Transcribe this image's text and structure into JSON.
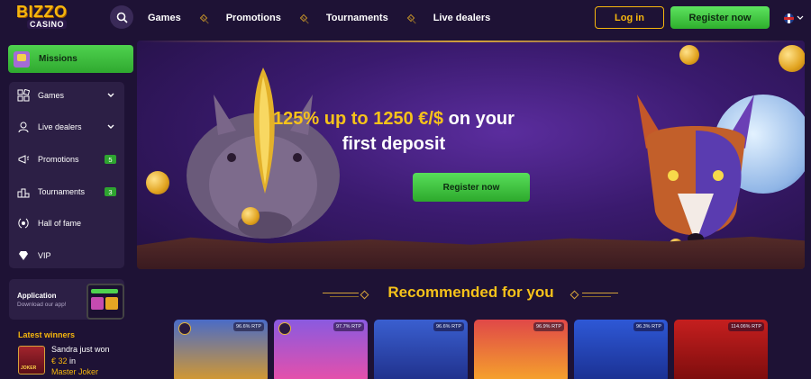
{
  "brand": {
    "line1": "BIZZO",
    "line2": "CASINO"
  },
  "nav": {
    "items": [
      "Games",
      "Promotions",
      "Tournaments",
      "Live dealers"
    ],
    "login_label": "Log in",
    "register_label": "Register now"
  },
  "sidebar": {
    "missions_label": "Missions",
    "items": [
      {
        "label": "Games",
        "icon": "games-icon",
        "has_chevron": true
      },
      {
        "label": "Live dealers",
        "icon": "dealer-icon",
        "has_chevron": true
      },
      {
        "label": "Promotions",
        "icon": "megaphone-icon",
        "badge": "5"
      },
      {
        "label": "Tournaments",
        "icon": "tournament-icon",
        "badge": "3"
      },
      {
        "label": "Hall of fame",
        "icon": "laurel-icon"
      },
      {
        "label": "VIP",
        "icon": "diamond-icon"
      }
    ],
    "app": {
      "title": "Application",
      "subtitle": "Download our app!"
    },
    "latest_winners": {
      "title": "Latest winners",
      "name": "Sandra just won",
      "amount": "€ 32",
      "amount_suffix": "in",
      "game": "Master Joker"
    }
  },
  "banner": {
    "headline_highlight": "125% up to 1250 €/$",
    "headline_rest1": " on your",
    "headline_line2": "first deposit",
    "button_label": "Register now"
  },
  "recommended": {
    "title": "Recommended for you",
    "games": [
      {
        "rtp": "96.6% RTP",
        "color_top": "#4a6bc7",
        "color_bottom": "#d89a2b"
      },
      {
        "rtp": "97.7% RTP",
        "color_top": "#8a5ae0",
        "color_bottom": "#e94fa8"
      },
      {
        "rtp": "96.6% RTP",
        "color_top": "#3a5fd0",
        "color_bottom": "#1f2f8a"
      },
      {
        "rtp": "96.9% RTP",
        "color_top": "#e04848",
        "color_bottom": "#f6a52b"
      },
      {
        "rtp": "96.3% RTP",
        "color_top": "#2e58d6",
        "color_bottom": "#1a2f90"
      },
      {
        "rtp": "114.06% RTP",
        "color_top": "#c51f1f",
        "color_bottom": "#7a0c0c"
      }
    ]
  },
  "colors": {
    "accent_gold": "#f6b60d",
    "accent_green": "#2eae2c",
    "background": "#1e1235"
  }
}
